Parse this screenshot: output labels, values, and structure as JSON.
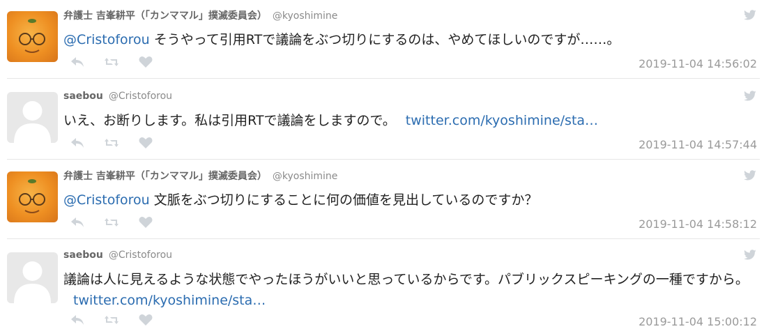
{
  "tweets": [
    {
      "name": "弁護士 吉峯耕平（「カンママル」撲滅委員会）",
      "handle": "@kyoshimine",
      "mention": "@Cristoforou",
      "body": " そうやって引用RTで議論をぶつ切りにするのは、やめてほしいのですが……。",
      "link": "",
      "time": "2019-11-04 14:56:02"
    },
    {
      "name": "saebou",
      "handle": "@Cristoforou",
      "mention": "",
      "body": "いえ、お断りします。私は引用RTで議論をしますので。",
      "link": "twitter.com/kyoshimine/sta…",
      "time": "2019-11-04 14:57:44"
    },
    {
      "name": "弁護士 吉峯耕平（「カンママル」撲滅委員会）",
      "handle": "@kyoshimine",
      "mention": "@Cristoforou",
      "body": " 文脈をぶつ切りにすることに何の価値を見出しているのですか？",
      "link": "",
      "time": "2019-11-04 14:58:12"
    },
    {
      "name": "saebou",
      "handle": "@Cristoforou",
      "mention": "",
      "body": "議論は人に見えるような状態でやったほうがいいと思っているからです。パブリックスピーキングの一種ですから。",
      "link": "twitter.com/kyoshimine/sta…",
      "time": "2019-11-04 15:00:12"
    }
  ],
  "icons": {
    "bird": "twitter-bird-icon",
    "reply": "reply-icon",
    "retweet": "retweet-icon",
    "like": "heart-icon"
  },
  "colors": {
    "link": "#2b6cb0",
    "muted": "#9a9a9a",
    "icon": "#cfd4d9"
  }
}
